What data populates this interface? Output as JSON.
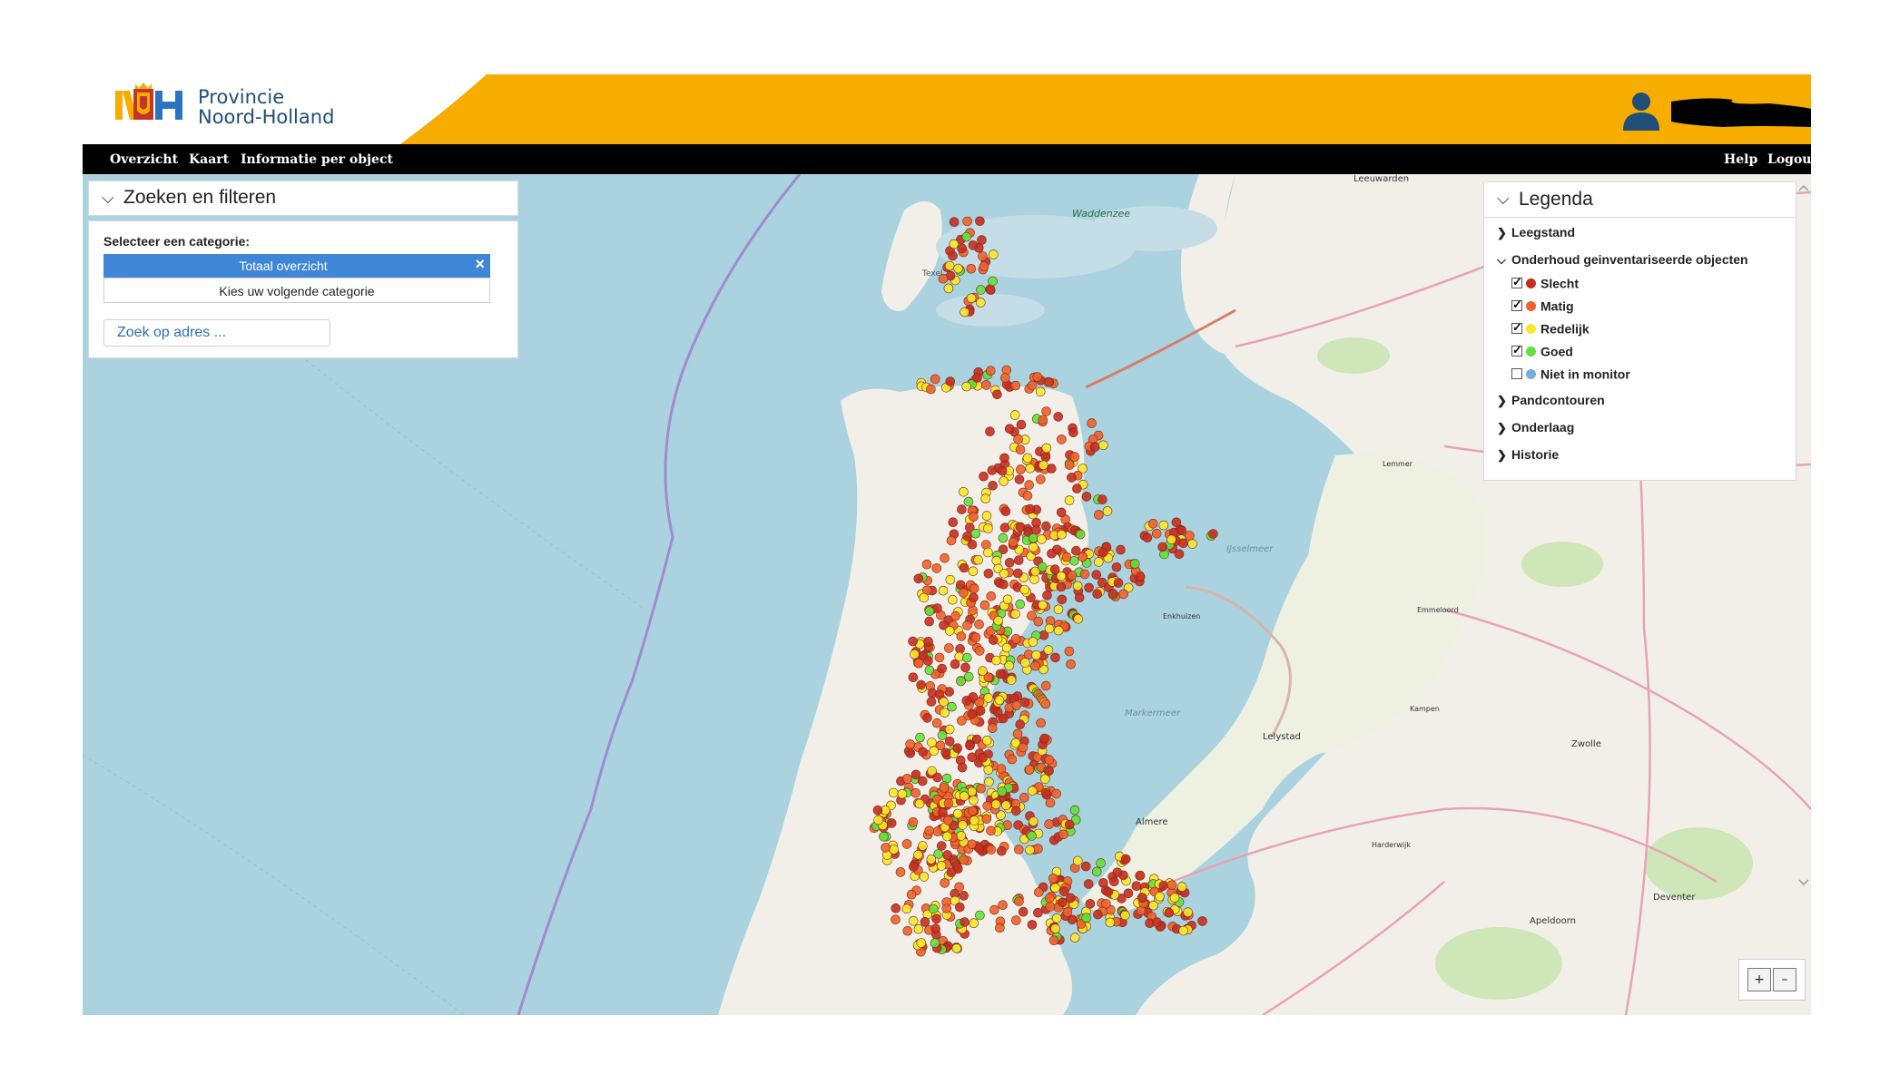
{
  "header": {
    "logo_line1": "Provincie",
    "logo_line2": "Noord-Holland",
    "accent_color": "#f7ad00"
  },
  "nav": {
    "left": [
      "Overzicht",
      "Kaart",
      "Informatie per object"
    ],
    "right": [
      "Help",
      "Logout"
    ]
  },
  "search_panel": {
    "title": "Zoeken en filteren",
    "category_label": "Selecteer een categorie:",
    "selected_category": "Totaal overzicht",
    "next_category": "Kies uw volgende categorie",
    "address_placeholder": "Zoek op adres ..."
  },
  "legend": {
    "title": "Legenda",
    "sections": [
      {
        "label": "Leegstand",
        "expanded": false
      },
      {
        "label": "Onderhoud geinventariseerde objecten",
        "expanded": true
      },
      {
        "label": "Pandcontouren",
        "expanded": false
      },
      {
        "label": "Onderlaag",
        "expanded": false
      },
      {
        "label": "Historie",
        "expanded": false
      }
    ],
    "items": [
      {
        "label": "Slecht",
        "color": "#c62d1f",
        "checked": true
      },
      {
        "label": "Matig",
        "color": "#f0622a",
        "checked": true
      },
      {
        "label": "Redelijk",
        "color": "#f7e92a",
        "checked": true
      },
      {
        "label": "Goed",
        "color": "#5fe33b",
        "checked": true
      },
      {
        "label": "Niet in monitor",
        "color": "#74aede",
        "checked": false
      }
    ]
  },
  "map": {
    "labels": {
      "waddenzee": "Waddenzee",
      "ijsselmeer": "IJsselmeer",
      "markermeer": "Markermeer",
      "texel": "Texel",
      "lelystad": "Lelystad",
      "almere": "Almere",
      "emmeloord": "Emmeloord",
      "zwolle": "Zwolle",
      "deventer": "Deventer",
      "apeldoorn": "Apeldoorn",
      "leeuwarden": "Leeuwarden",
      "harderwijk": "Harderwijk",
      "kampen": "Kampen",
      "lemmer": "Lemmer",
      "enkhuizen": "Enkhuizen"
    }
  },
  "zoom": {
    "plus": "+",
    "minus": "–"
  }
}
